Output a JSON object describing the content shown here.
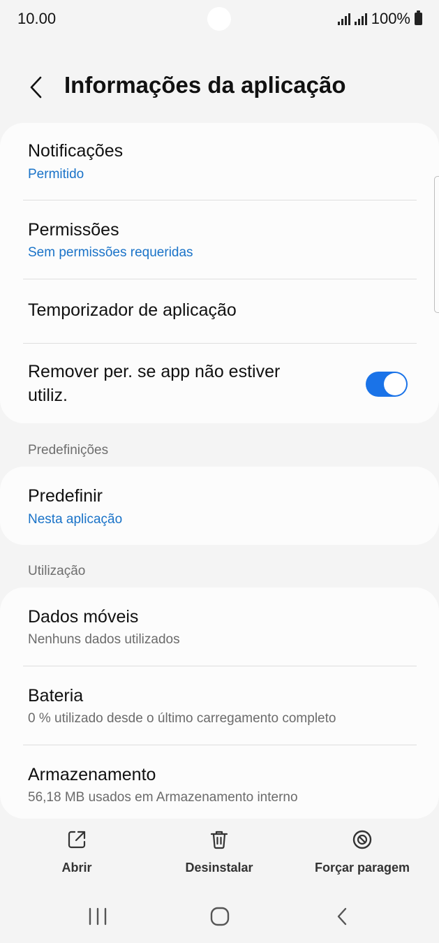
{
  "status": {
    "time": "10.00",
    "battery": "100%"
  },
  "header": {
    "title": "Informações da aplicação"
  },
  "card1": {
    "notifications": {
      "title": "Notificações",
      "sub": "Permitido"
    },
    "permissions": {
      "title": "Permissões",
      "sub": "Sem permissões requeridas"
    },
    "timer": {
      "title": "Temporizador de aplicação"
    },
    "remove": {
      "line1": "Remover per. se app não estiver",
      "line2": "utiliz.",
      "enabled": true
    }
  },
  "defaults_section": {
    "label": "Predefinições",
    "item": {
      "title": "Predefinir",
      "sub": "Nesta aplicação"
    }
  },
  "usage_section": {
    "label": "Utilização",
    "mobile_data": {
      "title": "Dados móveis",
      "sub": "Nenhuns dados utilizados"
    },
    "battery": {
      "title": "Bateria",
      "sub": "0 % utilizado desde o último carregamento completo"
    },
    "storage": {
      "title": "Armazenamento",
      "sub": "56,18 MB usados em Armazenamento interno"
    }
  },
  "actions": {
    "open": "Abrir",
    "uninstall": "Desinstalar",
    "force_stop": "Forçar paragem"
  },
  "colors": {
    "accent": "#1a73e8",
    "link": "#1a73c8",
    "background": "#f4f4f4",
    "card": "#fcfcfc"
  },
  "icons": [
    "back-icon",
    "open-external-icon",
    "trash-icon",
    "force-stop-icon",
    "recents-icon",
    "home-icon",
    "nav-back-icon"
  ]
}
